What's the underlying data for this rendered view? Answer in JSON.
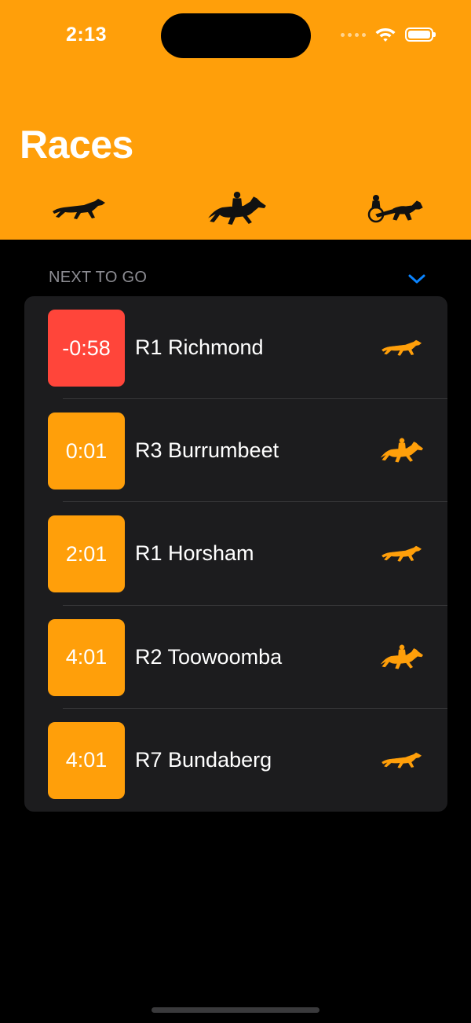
{
  "status_bar": {
    "time": "2:13"
  },
  "header": {
    "title": "Races",
    "filters": [
      {
        "name": "greyhound",
        "icon": "greyhound-icon"
      },
      {
        "name": "horse",
        "icon": "horse-jockey-icon"
      },
      {
        "name": "harness",
        "icon": "harness-icon"
      }
    ]
  },
  "section": {
    "title": "NEXT TO GO",
    "expanded": true
  },
  "races": [
    {
      "countdown": "-0:58",
      "name": "R1 Richmond",
      "category": "greyhound",
      "overdue": true
    },
    {
      "countdown": "0:01",
      "name": "R3 Burrumbeet",
      "category": "horse",
      "overdue": false
    },
    {
      "countdown": "2:01",
      "name": "R1 Horsham",
      "category": "greyhound",
      "overdue": false
    },
    {
      "countdown": "4:01",
      "name": "R2 Toowoomba",
      "category": "horse",
      "overdue": false
    },
    {
      "countdown": "4:01",
      "name": "R7 Bundaberg",
      "category": "greyhound",
      "overdue": false
    }
  ],
  "colors": {
    "accent": "#FF9F0A",
    "overdue": "#FF453A",
    "card": "#1C1C1E",
    "chevron": "#0A84FF",
    "secondary_text": "#8D8D93"
  }
}
